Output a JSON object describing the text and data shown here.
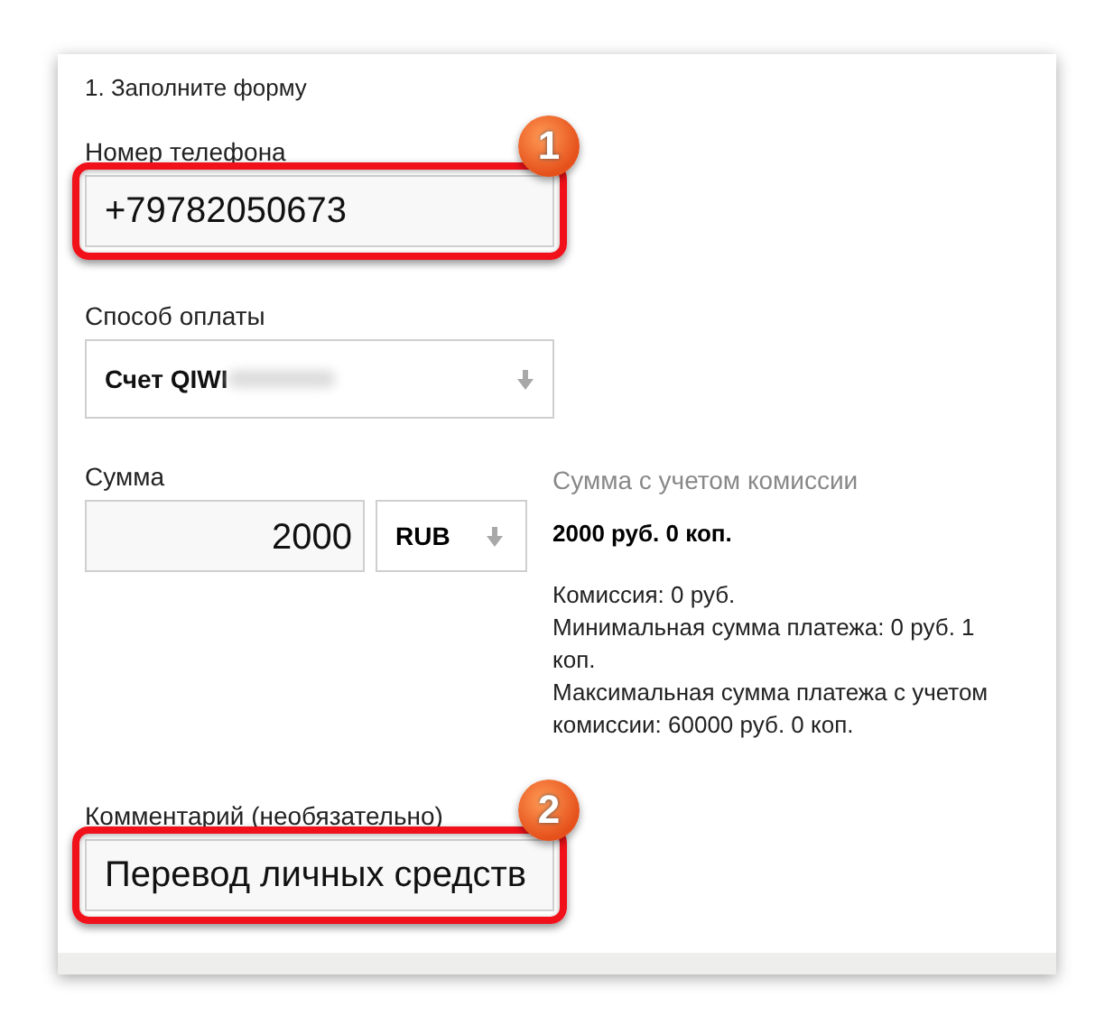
{
  "form": {
    "step_title": "1. Заполните форму",
    "phone": {
      "label": "Номер телефона",
      "value": "+79782050673",
      "callout": "1"
    },
    "payment_method": {
      "label": "Способ оплаты",
      "value": "Счет QIWI",
      "redacted": true
    },
    "amount": {
      "label": "Сумма",
      "value": "2000",
      "currency": "RUB"
    },
    "total": {
      "label": "Сумма с учетом комиссии",
      "value": "2000 руб. 0 коп.",
      "details": [
        "Комиссия: 0 руб.",
        "Минимальная сумма платежа: 0 руб. 1 коп.",
        "Максимальная сумма платежа с учетом комиссии: 60000 руб. 0 коп."
      ]
    },
    "comment": {
      "label": "Комментарий (необязательно)",
      "value": "Перевод личных средств",
      "callout": "2"
    }
  }
}
